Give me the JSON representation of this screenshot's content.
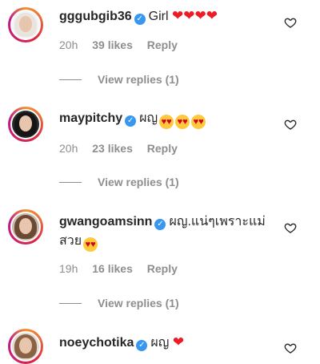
{
  "comments": [
    {
      "username": "gggubgib36",
      "text": "Girl",
      "emojis": [
        "heart",
        "heart",
        "heart",
        "heart"
      ],
      "time": "20h",
      "likes": "39 likes",
      "reply": "Reply",
      "view_replies": "View replies (1)",
      "avatar_colors": {
        "bg": "#f3f3f3",
        "hair": "#e9e4dd"
      }
    },
    {
      "username": "maypitchy",
      "text": "ผญ",
      "emojis": [
        "heart-eyes",
        "heart-eyes",
        "heart-eyes"
      ],
      "time": "20h",
      "likes": "23 likes",
      "reply": "Reply",
      "view_replies": "View replies (1)",
      "avatar_colors": {
        "bg": "#2a2a2a",
        "hair": "#151515"
      }
    },
    {
      "username": "gwangoamsinn",
      "text": "ผญ.แน่ๆเพราะแม่สวย",
      "emojis": [
        "heart-eyes"
      ],
      "time": "19h",
      "likes": "16 likes",
      "reply": "Reply",
      "view_replies": "View replies (1)",
      "avatar_colors": {
        "bg": "#c9b7a8",
        "hair": "#6b4a34"
      }
    },
    {
      "username": "noeychotika",
      "text": "ผญ",
      "emojis": [
        "heart"
      ],
      "avatar_colors": {
        "bg": "#e4d9cf",
        "hair": "#8a6246"
      }
    }
  ],
  "colors": {
    "verified": "#3897f0",
    "muted": "#8e8e8e",
    "text": "#262626",
    "heart": "#ed1c24"
  }
}
